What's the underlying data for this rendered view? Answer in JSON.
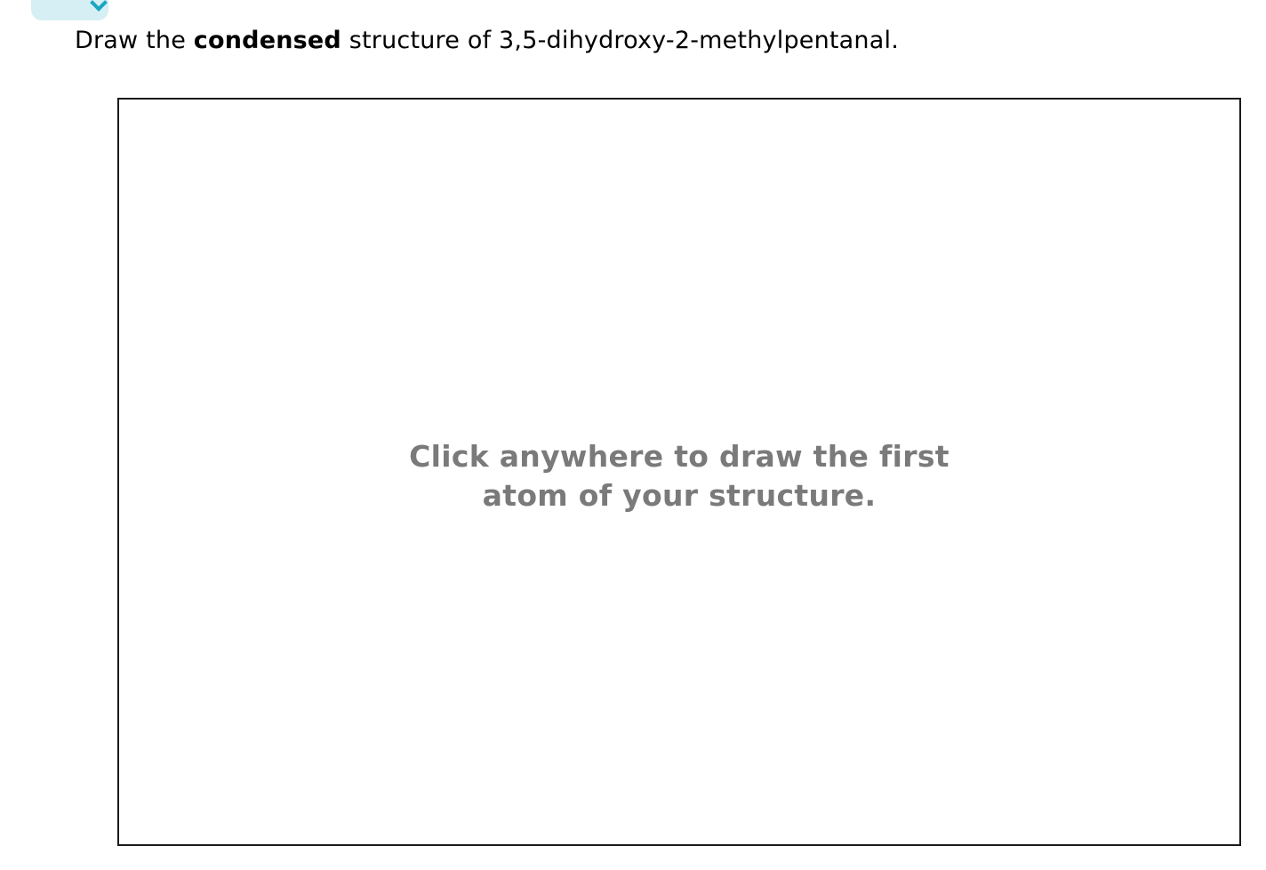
{
  "question": {
    "prefix": "Draw the ",
    "emphasis": "condensed",
    "suffix": " structure of 3,5-dihydroxy-2-methylpentanal."
  },
  "canvas": {
    "hint_line1": "Click anywhere to draw the first",
    "hint_line2": "atom of your structure."
  },
  "colors": {
    "tab_bg": "#d6eff4",
    "tab_icon": "#1aa6c2",
    "hint_text": "#7a7a7a"
  },
  "icons": {
    "top_tab": "chevron-down-icon"
  }
}
